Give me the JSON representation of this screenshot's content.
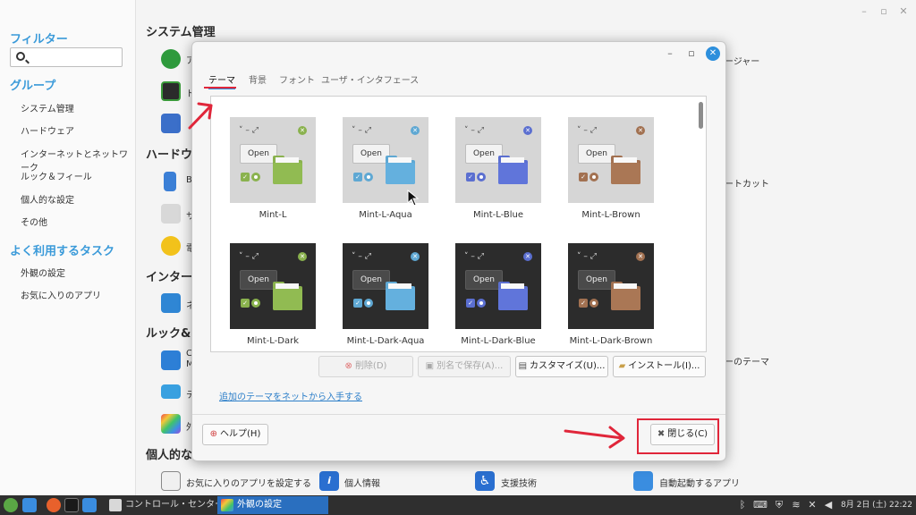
{
  "control_center": {
    "sidebar": {
      "filter_heading": "フィルター",
      "search_placeholder": "",
      "group_heading": "グループ",
      "groups": [
        "システム管理",
        "ハードウェア",
        "インターネットとネットワーク",
        "ルック＆フィール",
        "個人的な設定",
        "その他"
      ],
      "tasks_heading": "よく利用するタスク",
      "tasks": [
        "外観の設定",
        "お気に入りのアプリ"
      ]
    },
    "sections": {
      "system": "システム管理",
      "hardware": "ハードウェ",
      "internet": "インター",
      "look": "ルック&フ",
      "personal": "個人的な設定"
    },
    "partial_labels": {
      "a": "ア",
      "d": "ド",
      "b": "B",
      "sa": "サ",
      "den": "電",
      "ne": "ネ",
      "c": "C",
      "m": "M",
      "te": "テ",
      "gai": "外",
      "manager": "ージャー",
      "shortcut": "ートカット",
      "theme": "ーのテーマ"
    },
    "personal_apps": [
      "お気に入りのアプリを設定する",
      "個人情報",
      "支援技術",
      "自動起動するアプリ"
    ]
  },
  "dialog": {
    "tabs": [
      "テーマ",
      "背景",
      "フォント",
      "ユーザ・インタフェース"
    ],
    "preview": {
      "open_label": "Open",
      "controls": "˅  –      ⤢"
    },
    "themes": [
      {
        "name": "Mint-L",
        "accent": "#8ab24e",
        "dark": false
      },
      {
        "name": "Mint-L-Aqua",
        "accent": "#5fa8d3",
        "dark": false
      },
      {
        "name": "Mint-L-Blue",
        "accent": "#5b6fd0",
        "dark": false
      },
      {
        "name": "Mint-L-Brown",
        "accent": "#a27151",
        "dark": false
      },
      {
        "name": "Mint-L-Dark",
        "accent": "#8ab24e",
        "dark": true
      },
      {
        "name": "Mint-L-Dark-Aqua",
        "accent": "#5fa8d3",
        "dark": true
      },
      {
        "name": "Mint-L-Dark-Blue",
        "accent": "#5b6fd0",
        "dark": true
      },
      {
        "name": "Mint-L-Dark-Brown",
        "accent": "#a27151",
        "dark": true
      }
    ],
    "buttons": {
      "delete": "削除(D)",
      "save_as": "別名で保存(A)...",
      "customize": "カスタマイズ(U)...",
      "install": "インストール(I)...",
      "help": "ヘルプ(H)",
      "close": "閉じる(C)"
    },
    "link": "追加のテーマをネットから入手する"
  },
  "taskbar": {
    "tasks": [
      "コントロール・センター",
      "外観の設定"
    ],
    "clock": "8月 2日 (土) 22:22"
  },
  "colors": {
    "accent": "#2d8fdc",
    "annotation": "#e0263a"
  }
}
